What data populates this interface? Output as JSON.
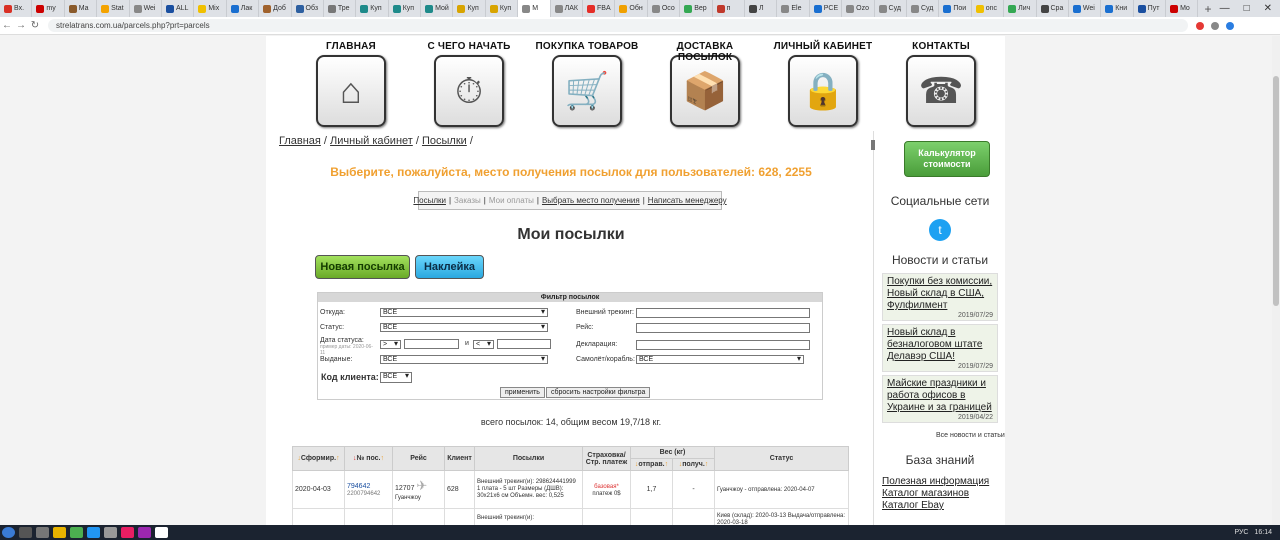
{
  "browser": {
    "tabs": [
      {
        "label": "Вх.",
        "color": "#d93025"
      },
      {
        "label": "my",
        "color": "#c00"
      },
      {
        "label": "Ma",
        "color": "#8a5a2b"
      },
      {
        "label": "Stat",
        "color": "#f4a300"
      },
      {
        "label": "Wei",
        "color": "#888"
      },
      {
        "label": "ALL",
        "color": "#1a4fa0"
      },
      {
        "label": "Mix",
        "color": "#f0c000"
      },
      {
        "label": "Лак",
        "color": "#1a6fd0"
      },
      {
        "label": "Доб",
        "color": "#a0622d"
      },
      {
        "label": "Обз",
        "color": "#2d5fa0"
      },
      {
        "label": "Тре",
        "color": "#777"
      },
      {
        "label": "Куп",
        "color": "#1e8a8a"
      },
      {
        "label": "Куп",
        "color": "#1e8a8a"
      },
      {
        "label": "Мой",
        "color": "#1e8a8a"
      },
      {
        "label": "Куп",
        "color": "#d8a400"
      },
      {
        "label": "Куп",
        "color": "#d8a400"
      },
      {
        "label": "М",
        "color": "#888",
        "active": true
      },
      {
        "label": "ЛАК",
        "color": "#888"
      },
      {
        "label": "FBA",
        "color": "#e52d27"
      },
      {
        "label": "Обн",
        "color": "#f0a000"
      },
      {
        "label": "Осо",
        "color": "#888"
      },
      {
        "label": "Вер",
        "color": "#34a853"
      },
      {
        "label": "п",
        "color": "#c0392b"
      },
      {
        "label": "Л",
        "color": "#444"
      },
      {
        "label": "Ele",
        "color": "#888"
      },
      {
        "label": "PCE",
        "color": "#1a6fd0"
      },
      {
        "label": "Ozo",
        "color": "#888"
      },
      {
        "label": "Суд",
        "color": "#888"
      },
      {
        "label": "Суд",
        "color": "#888"
      },
      {
        "label": "Пои",
        "color": "#1a6fd0"
      },
      {
        "label": "onc",
        "color": "#f0c000"
      },
      {
        "label": "Лич",
        "color": "#34a853"
      },
      {
        "label": "Сра",
        "color": "#444"
      },
      {
        "label": "Wei",
        "color": "#1a6fd0"
      },
      {
        "label": "Кни",
        "color": "#1a6fd0"
      },
      {
        "label": "Пут",
        "color": "#1a4fa0"
      },
      {
        "label": "Mo",
        "color": "#c00"
      }
    ],
    "url": "strelatrans.com.ua/parcels.php?prt=parcels"
  },
  "nav": [
    {
      "label": "ГЛАВНАЯ",
      "glyph": "⌂"
    },
    {
      "label": "С ЧЕГО НАЧАТЬ",
      "glyph": "⏱"
    },
    {
      "label": "ПОКУПКА ТОВАРОВ",
      "glyph": "🛒"
    },
    {
      "label": "ДОСТАВКА ПОСЫЛОК",
      "glyph": "📦"
    },
    {
      "label": "ЛИЧНЫЙ КАБИНЕТ",
      "glyph": "🔒"
    },
    {
      "label": "КОНТАКТЫ",
      "glyph": "☎"
    }
  ],
  "breadcrumbs": [
    "Главная",
    "Личный кабинет",
    "Посылки"
  ],
  "headline": "Выберите, пожалуйста, место получения посылок для пользователей: 628, 2255",
  "subtabs": {
    "parcels": "Посылки",
    "orders": "Заказы",
    "payments": "Мои оплаты",
    "choose_place": "Выбрать место получения",
    "write_manager": "Написать менеджеру"
  },
  "title": "Мои посылки",
  "buttons": {
    "new_parcel": "Новая посылка",
    "sticker": "Наклейка"
  },
  "filter": {
    "title": "Фильтр посылок",
    "from_label": "Откуда:",
    "from_value": "ВСЕ",
    "status_label": "Статус:",
    "status_value": "ВСЕ",
    "status_date_label": "Дата статуса:",
    "status_date_hint": "пример даты: 2020-06-11",
    "gt": ">",
    "and": "и",
    "lt": "<",
    "issued_label": "Выданые:",
    "issued_value": "ВСЕ",
    "ext_tracking_label": "Внешний трекинг:",
    "flight_label": "Рейс:",
    "declaration_label": "Декларация:",
    "plane_label": "Самолёт/корабль:",
    "plane_value": "ВСЕ",
    "client_code_label": "Код клиента:",
    "client_code_value": "ВСЕ",
    "apply": "применить",
    "reset": "сбросить настройки фильтра"
  },
  "totals": "всего посылок: 14, общим весом 19,7/18 кг.",
  "table": {
    "headers": {
      "formed": "Сформир.",
      "num": "№ пос.",
      "flight": "Рейс",
      "client": "Клиент",
      "parcels": "Посылки",
      "insurance": "Страховка/ Стр. платеж",
      "weight": "Вес (кг)",
      "sent": "отправ.",
      "received": "получ.",
      "status": "Статус"
    },
    "rows": [
      {
        "formed": "2020-04-03",
        "num": "794642",
        "num_sub": "2200794642",
        "flight": "12707",
        "flight_sub": "Гуанчжоу",
        "client": "628",
        "parcels": "Внешний трекинг(и): 298624441999 1 плата - 5 шт Размеры (ДШВ): 30x21x6 см Объемн. вес: 0,525",
        "insurance": "базовая*",
        "insurance_sub": "платеж 0$",
        "sent": "1,7",
        "received": "-",
        "status": "Гуанчжоу - отправлена: 2020-04-07"
      },
      {
        "formed": "",
        "num": "",
        "num_sub": "",
        "flight": "",
        "flight_sub": "",
        "client": "",
        "parcels": "Внешний трекинг(и):",
        "insurance": "",
        "insurance_sub": "",
        "sent": "",
        "received": "",
        "status": "Киев (склад): 2020-03-13 Выдача/отправлена: 2020-03-18"
      }
    ]
  },
  "sidebar": {
    "calc": "Калькулятор стоимости",
    "social": "Социальные сети",
    "news_title": "Новости и статьи",
    "news": [
      {
        "title": "Покупки без комиссии, Новый склад в США, Фулфилмент",
        "date": "2019/07/29"
      },
      {
        "title": "Новый склад в безналоговом штате Делавэр США!",
        "date": "2019/07/29"
      },
      {
        "title": "Майские праздники и работа офисов в Украине и за границей",
        "date": "2019/04/22"
      }
    ],
    "all_news": "Все новости и статьи",
    "kb_title": "База знаний",
    "kb": [
      "Полезная информация",
      "Каталог магазинов",
      "Каталог Ebay"
    ]
  },
  "taskbar": {
    "lang": "РУС",
    "time": "16:14"
  }
}
